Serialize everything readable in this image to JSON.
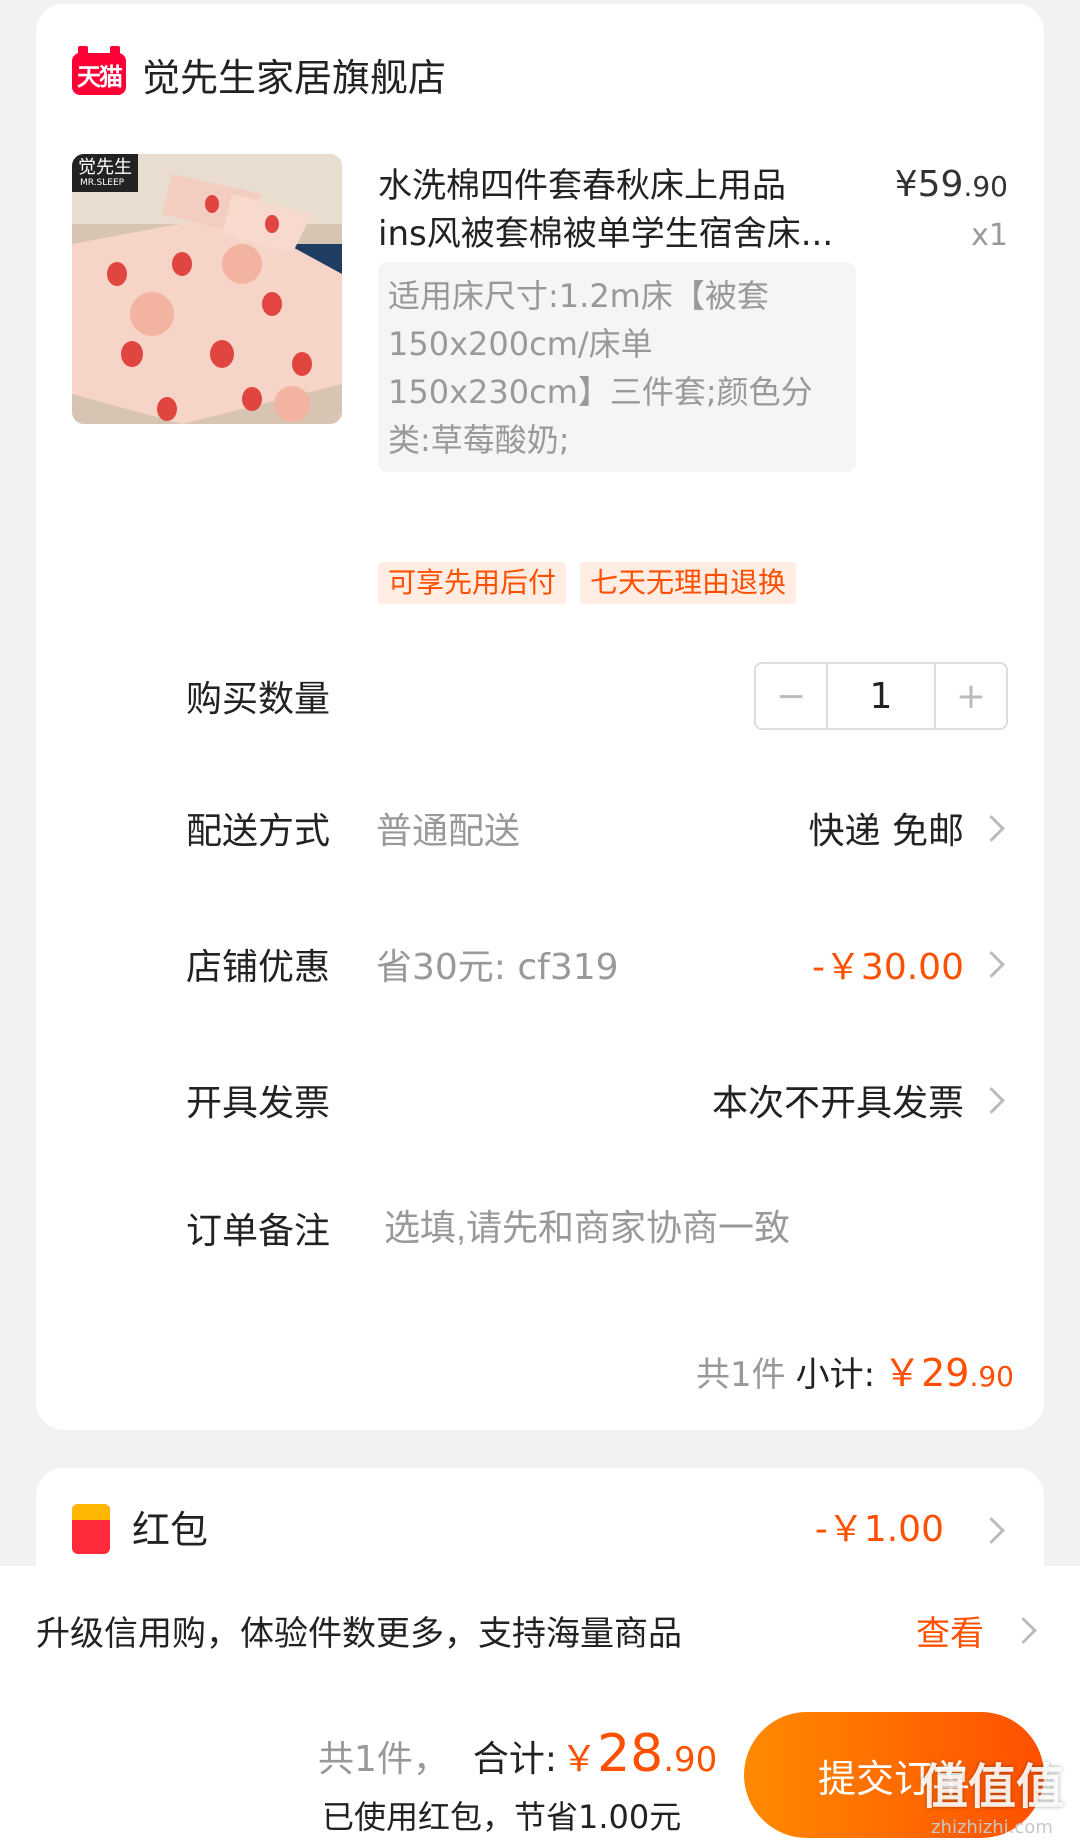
{
  "shop": {
    "badge": "天猫",
    "name": "觉先生家居旗舰店"
  },
  "product": {
    "image_brand": "觉先生",
    "image_brand_en": "MR.SLEEP",
    "title_line1": "水洗棉四件套春秋床上用品",
    "title_line2": "ins风被套棉被单学生宿舍床...",
    "price_symbol": "¥",
    "price_int": "59",
    "price_dec": ".90",
    "quantity": "x1",
    "sku": "适用床尺寸:1.2m床【被套150x200cm/床单150x230cm】三件套;颜色分类:草莓酸奶;",
    "tags": [
      "可享先用后付",
      "七天无理由退换"
    ]
  },
  "order": {
    "qty_label": "购买数量",
    "qty_value": "1",
    "qty_minus": "−",
    "qty_plus": "+",
    "delivery_label": "配送方式",
    "delivery_sub": "普通配送",
    "delivery_value": "快递 免邮",
    "discount_label": "店铺优惠",
    "discount_sub": "省30元: cf319",
    "discount_value": "-￥30.00",
    "invoice_label": "开具发票",
    "invoice_value": "本次不开具发票",
    "remark_label": "订单备注",
    "remark_placeholder": "选填,请先和商家协商一致",
    "subtotal_count": "共1件",
    "subtotal_label": "小计:",
    "subtotal_symbol": "￥",
    "subtotal_int": "29",
    "subtotal_dec": ".90"
  },
  "redpacket": {
    "label": "红包",
    "value": "-￥1.00"
  },
  "bottom": {
    "credit_text": "升级信用购，体验件数更多，支持海量商品",
    "credit_link": "查看",
    "total_count": "共1件，",
    "total_label": "合计:",
    "total_symbol": "￥",
    "total_int": "28",
    "total_dec": ".90",
    "saved_text": "已使用红包，节省1.00元",
    "submit_label": "提交订单"
  },
  "watermark": {
    "big": "值值值",
    "small": "zhizhizhi.com"
  },
  "colors": {
    "accent": "#ff5000",
    "tmall": "#ff0036",
    "background": "#f2f2f2"
  }
}
